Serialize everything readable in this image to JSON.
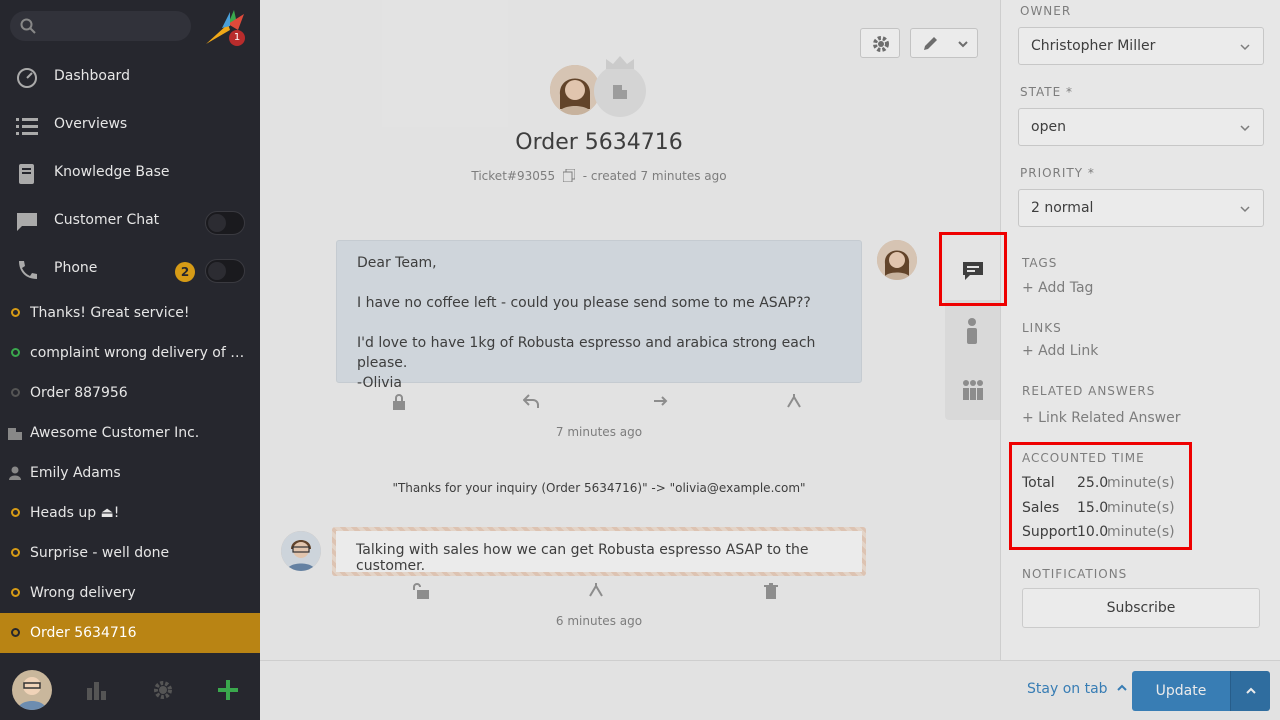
{
  "sidebar": {
    "logo_badge": "1",
    "nav": [
      {
        "label": "Dashboard",
        "icon": "dashboard-icon"
      },
      {
        "label": "Overviews",
        "icon": "overviews-icon"
      },
      {
        "label": "Knowledge Base",
        "icon": "knowledge-base-icon"
      },
      {
        "label": "Customer Chat",
        "icon": "chat-icon"
      },
      {
        "label": "Phone",
        "icon": "phone-icon",
        "badge": "2"
      }
    ],
    "tasks": [
      {
        "label": "Thanks! Great service!",
        "status": "open"
      },
      {
        "label": "complaint wrong delivery of ord...",
        "status": "new"
      },
      {
        "label": "Order 887956",
        "status": "closed"
      },
      {
        "label": "Awesome Customer Inc.",
        "type": "organization"
      },
      {
        "label": "Emily Adams",
        "type": "user"
      },
      {
        "label": "Heads up ⏏!",
        "status": "open"
      },
      {
        "label": "Surprise - well done",
        "status": "open"
      },
      {
        "label": "Wrong delivery",
        "status": "open"
      },
      {
        "label": "Order 5634716",
        "status": "open",
        "active": true
      }
    ]
  },
  "ticket": {
    "title": "Order 5634716",
    "number": "Ticket#93055",
    "created": "- created 7 minutes ago",
    "article1": {
      "body": "Dear Team,\n\nI have no coffee left - could you please send some to me ASAP??\n\nI'd love to have 1kg of Robusta espresso and arabica strong each please.\n-Olivia",
      "time": "7 minutes ago"
    },
    "system_line": "\"Thanks for your inquiry (Order 5634716)\" -> \"olivia@example.com\"",
    "note": {
      "body": "Talking with sales how we can get Robusta espresso ASAP to the customer.",
      "time": "6 minutes ago"
    }
  },
  "attributes": {
    "owner_label": "OWNER",
    "owner_value": "Christopher Miller",
    "state_label": "STATE *",
    "state_value": "open",
    "priority_label": "PRIORITY *",
    "priority_value": "2 normal",
    "tags_label": "TAGS",
    "tags_add": "+ Add Tag",
    "links_label": "LINKS",
    "links_add": "+ Add Link",
    "related_label": "RELATED ANSWERS",
    "related_add": "+ Link Related Answer",
    "accounted_label": "ACCOUNTED TIME",
    "accounted": [
      {
        "k": "Total",
        "v": "25.0",
        "u": "minute(s)"
      },
      {
        "k": "Sales",
        "v": "15.0",
        "u": "minute(s)"
      },
      {
        "k": "Support",
        "v": "10.0",
        "u": "minute(s)"
      }
    ],
    "notifications_label": "NOTIFICATIONS",
    "subscribe": "Subscribe"
  },
  "bottom": {
    "stay_on_tab": "Stay on tab",
    "update": "Update"
  },
  "colors": {
    "accent": "#3d88c4",
    "active_task": "#b98414",
    "highlight": "#ee0000"
  }
}
